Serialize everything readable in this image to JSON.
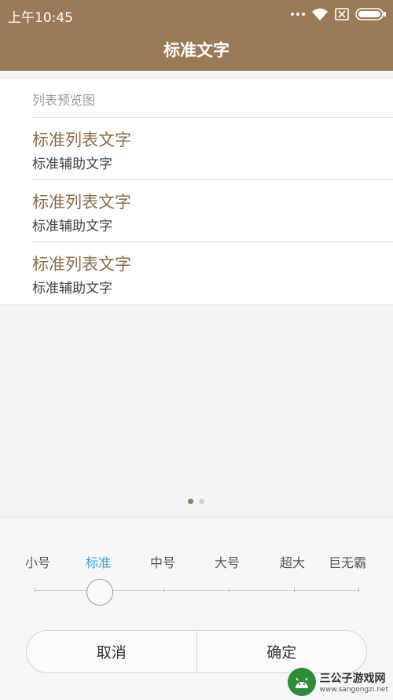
{
  "status": {
    "time": "上午10:45"
  },
  "header": {
    "title": "标准文字"
  },
  "preview": {
    "label": "列表预览图",
    "rows": [
      {
        "primary": "标准列表文字",
        "secondary": "标准辅助文字"
      },
      {
        "primary": "标准列表文字",
        "secondary": "标准辅助文字"
      },
      {
        "primary": "标准列表文字",
        "secondary": "标准辅助文字"
      }
    ]
  },
  "pager": {
    "pages": 2,
    "current": 1
  },
  "sizes": {
    "options": [
      "小号",
      "标准",
      "中号",
      "大号",
      "超大",
      "巨无霸"
    ],
    "selected_index": 1
  },
  "actions": {
    "cancel": "取消",
    "confirm": "确定"
  },
  "watermark": {
    "title": "三公子游戏网",
    "url": "www.sangongzi.net"
  },
  "colors": {
    "header": "#9b7a57",
    "accent": "#3aa7e0",
    "list_text": "#8b6b4a"
  }
}
